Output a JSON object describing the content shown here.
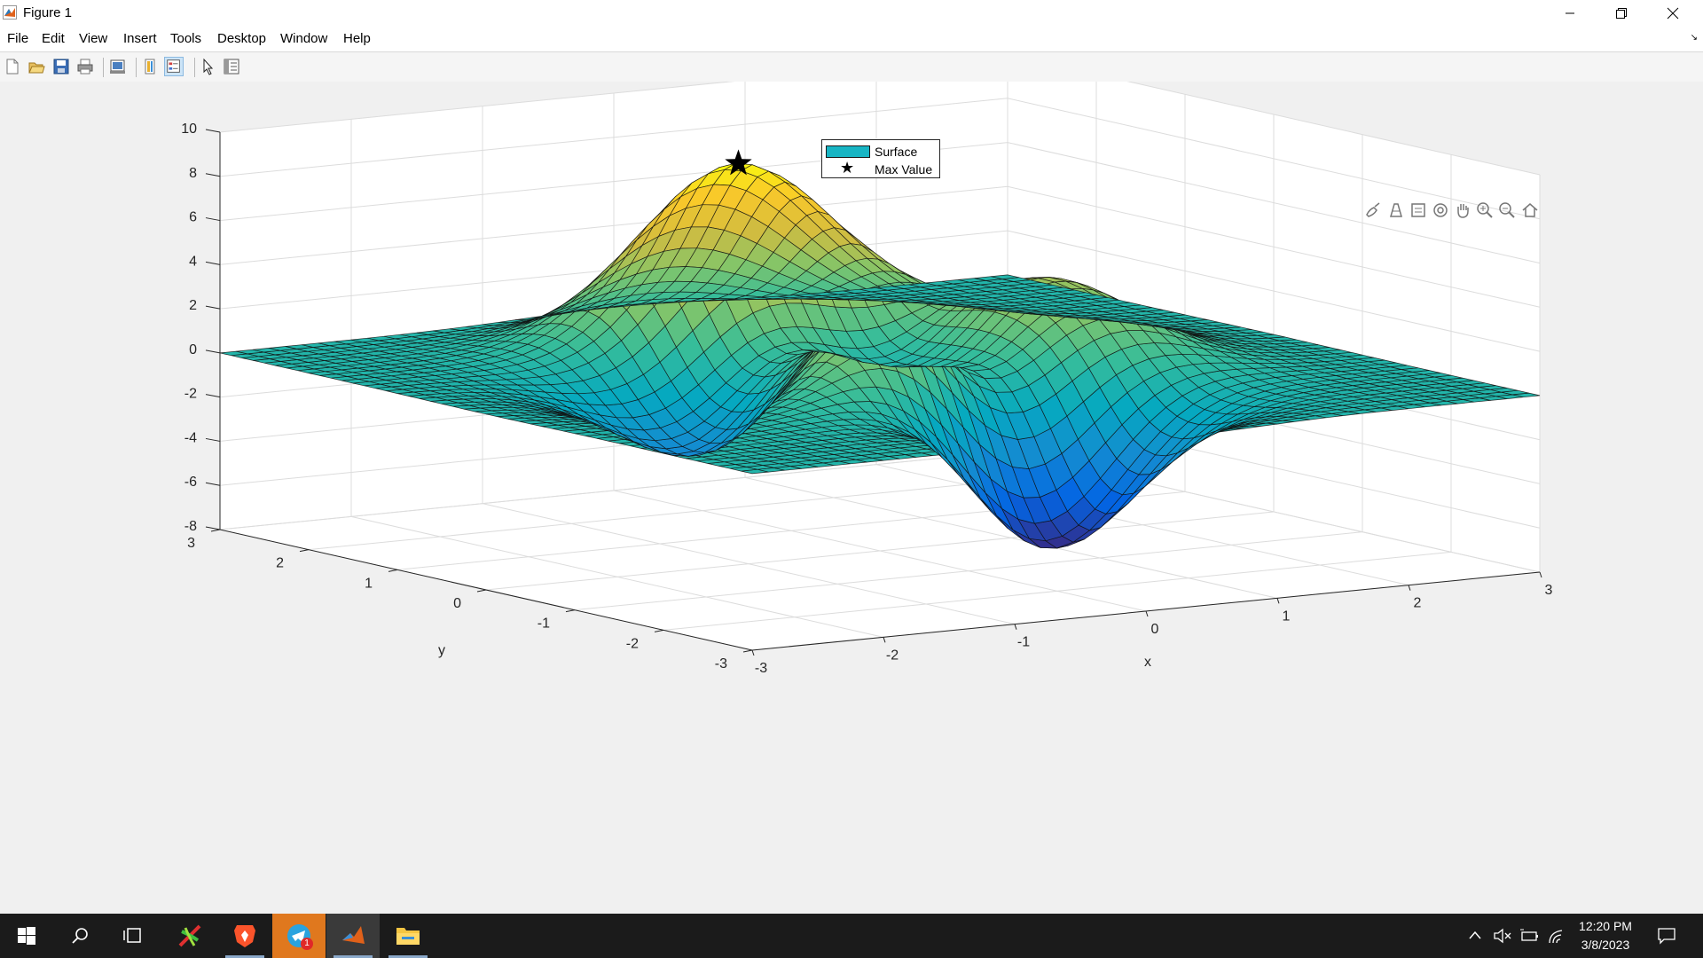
{
  "window": {
    "title": "Figure 1",
    "minimize_icon": "minimize-icon",
    "restore_icon": "restore-icon",
    "close_icon": "close-icon"
  },
  "menu": {
    "items": [
      "File",
      "Edit",
      "View",
      "Insert",
      "Tools",
      "Desktop",
      "Window",
      "Help"
    ]
  },
  "toolbar": {
    "icons": [
      "new-figure-icon",
      "open-file-icon",
      "save-icon",
      "print-icon",
      "link-plot-icon",
      "colorbar-icon",
      "legend-icon",
      "edit-plot-arrow-icon",
      "property-inspector-icon"
    ]
  },
  "axes_toolbar": {
    "icons": [
      "brush-icon",
      "data-tip-icon",
      "export-icon",
      "rotate-3d-icon",
      "pan-hand-icon",
      "zoom-in-icon",
      "zoom-out-icon",
      "home-icon"
    ]
  },
  "legend": {
    "entries": [
      {
        "label": "Surface",
        "color": "#17b5c4"
      },
      {
        "label": "Max Value",
        "marker": "star"
      }
    ]
  },
  "chart_data": {
    "type": "surface",
    "function": "peaks",
    "xlabel": "x",
    "ylabel": "y",
    "zlabel": "",
    "xlim": [
      -3,
      3
    ],
    "ylim": [
      -3,
      3
    ],
    "zlim": [
      -8,
      10
    ],
    "xticks": [
      -3,
      -2,
      -1,
      0,
      1,
      2,
      3
    ],
    "yticks": [
      -3,
      -2,
      -1,
      0,
      1,
      2,
      3
    ],
    "zticks": [
      -8,
      -6,
      -4,
      -2,
      0,
      2,
      4,
      6,
      8,
      10
    ],
    "grid": true,
    "colormap": "parula",
    "grid_resolution": 49,
    "series": [
      {
        "name": "Surface",
        "type": "surface"
      },
      {
        "name": "Max Value",
        "type": "marker",
        "marker": "star",
        "x": -0.0092,
        "y": 1.5814,
        "z": 8.1062
      }
    ],
    "legend_position": "top-center"
  },
  "taskbar": {
    "icons": [
      "windows-start-icon",
      "search-icon",
      "task-view-icon",
      "app-icon",
      "brave-browser-icon",
      "telegram-icon",
      "matlab-icon",
      "file-explorer-icon"
    ],
    "telegram_badge": "1",
    "tray_icons": [
      "chevron-up-icon",
      "volume-muted-icon",
      "battery-icon",
      "wifi-icon"
    ],
    "time": "12:20 PM",
    "date": "3/8/2023",
    "notification_icon": "notification-icon"
  }
}
